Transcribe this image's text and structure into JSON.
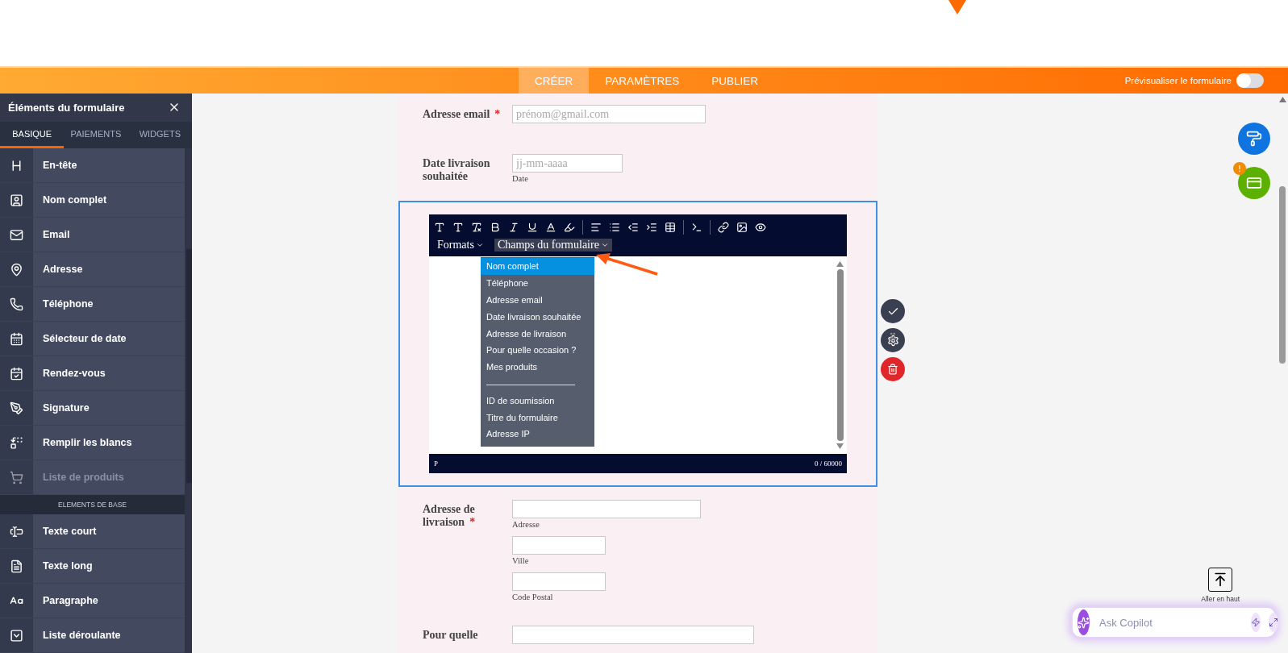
{
  "top_bar": {
    "tabs": [
      {
        "label": "CRÉER",
        "selected": true
      },
      {
        "label": "PARAMÈTRES",
        "selected": false
      },
      {
        "label": "PUBLIER",
        "selected": false
      }
    ],
    "preview": {
      "label": "Prévisualiser le formulaire",
      "on": false
    }
  },
  "sidebar": {
    "title": "Éléments du formulaire",
    "tabs": [
      {
        "label": "BASIQUE",
        "selected": true
      },
      {
        "label": "PAIEMENTS",
        "selected": false
      },
      {
        "label": "WIDGETS",
        "selected": false
      }
    ],
    "items": [
      {
        "kind": "item",
        "label": "En-tête",
        "disabled": false
      },
      {
        "kind": "item",
        "label": "Nom complet",
        "disabled": false
      },
      {
        "kind": "item",
        "label": "Email",
        "disabled": false
      },
      {
        "kind": "item",
        "label": "Adresse",
        "disabled": false
      },
      {
        "kind": "item",
        "label": "Téléphone",
        "disabled": false
      },
      {
        "kind": "item",
        "label": "Sélecteur de date",
        "disabled": false
      },
      {
        "kind": "item",
        "label": "Rendez-vous",
        "disabled": false
      },
      {
        "kind": "item",
        "label": "Signature",
        "disabled": false
      },
      {
        "kind": "item",
        "label": "Remplir les blancs",
        "disabled": false
      },
      {
        "kind": "item",
        "label": "Liste de produits",
        "disabled": true
      },
      {
        "kind": "section",
        "label": "ELEMENTS DE BASE"
      },
      {
        "kind": "item",
        "label": "Texte court",
        "disabled": false
      },
      {
        "kind": "item",
        "label": "Texte long",
        "disabled": false
      },
      {
        "kind": "item",
        "label": "Paragraphe",
        "disabled": false
      },
      {
        "kind": "item",
        "label": "Liste déroulante",
        "disabled": false
      }
    ]
  },
  "form": {
    "fields": [
      {
        "kind": "email",
        "label": "Adresse email",
        "required": true,
        "placeholder": "prénom@gmail.com"
      },
      {
        "kind": "date",
        "label": "Date livraison souhaitée",
        "required": false,
        "placeholder": "jj-mm-aaaa",
        "sublabel": "Date"
      },
      {
        "kind": "editor",
        "formats": "Formats",
        "fields_menu": "Champs du formulaire",
        "menu": [
          {
            "kind": "item",
            "label": "Nom complet",
            "selected": true
          },
          {
            "kind": "item",
            "label": "Téléphone",
            "selected": false
          },
          {
            "kind": "item",
            "label": "Adresse email",
            "selected": false
          },
          {
            "kind": "item",
            "label": "Date livraison souhaitée",
            "selected": false
          },
          {
            "kind": "item",
            "label": "Adresse de livraison",
            "selected": false
          },
          {
            "kind": "item",
            "label": "Pour quelle occasion ?",
            "selected": false
          },
          {
            "kind": "item",
            "label": "Mes produits",
            "selected": false
          },
          {
            "kind": "separator",
            "label": "——————————"
          },
          {
            "kind": "item",
            "label": "ID de soumission",
            "selected": false
          },
          {
            "kind": "item",
            "label": "Titre du formulaire",
            "selected": false
          },
          {
            "kind": "item",
            "label": "Adresse IP",
            "selected": false
          }
        ],
        "path": "P",
        "counter": "0 / 60000"
      },
      {
        "kind": "address",
        "label": "Adresse de livraison",
        "required": true,
        "inputs": [
          {
            "sublabel": "Adresse"
          },
          {
            "sublabel": "Ville"
          },
          {
            "sublabel": "Code Postal"
          }
        ]
      },
      {
        "kind": "partial",
        "label": "Pour quelle",
        "required": false
      }
    ]
  },
  "required_mark": "*",
  "payment_badge": "!",
  "go_top": {
    "label": "Aller en haut"
  },
  "copilot": {
    "placeholder": "Ask Copilot"
  }
}
